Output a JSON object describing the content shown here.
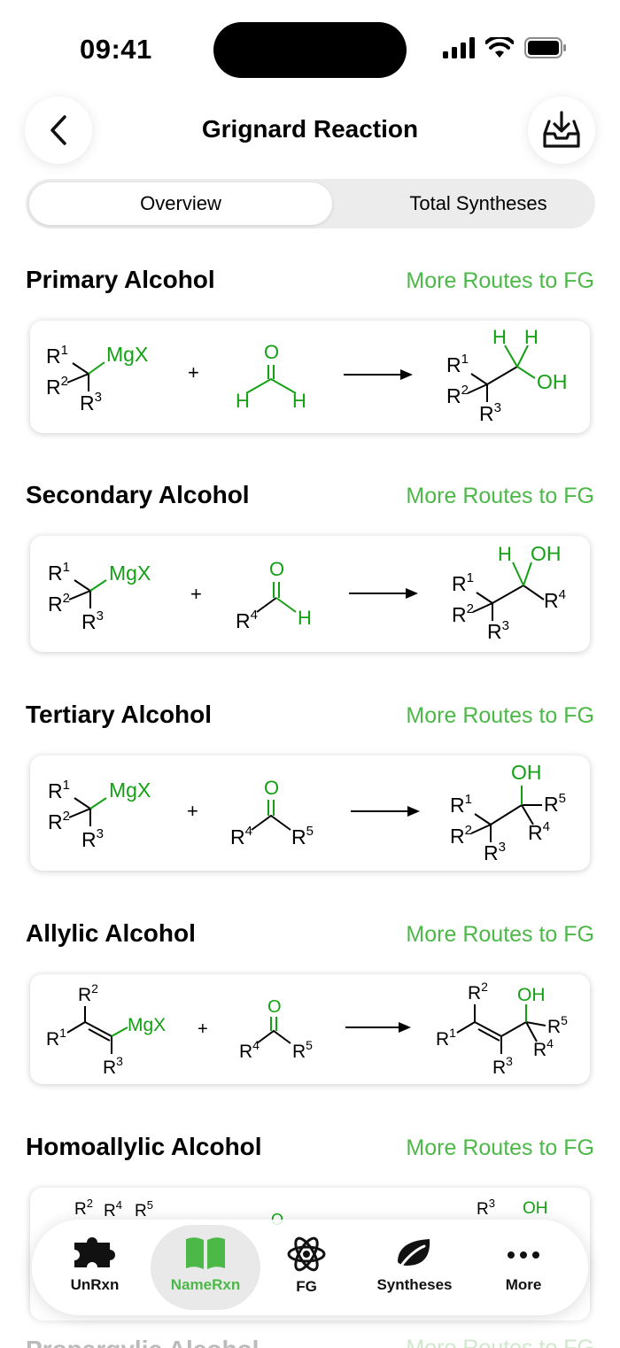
{
  "status_bar": {
    "time": "09:41"
  },
  "nav": {
    "title": "Grignard Reaction"
  },
  "segments": {
    "overview": "Overview",
    "total_syntheses": "Total Syntheses"
  },
  "sections": [
    {
      "title": "Primary Alcohol",
      "link": "More Routes to FG"
    },
    {
      "title": "Secondary Alcohol",
      "link": "More Routes to FG"
    },
    {
      "title": "Tertiary Alcohol",
      "link": "More Routes to FG"
    },
    {
      "title": "Allylic Alcohol",
      "link": "More Routes to FG"
    },
    {
      "title": "Homoallylic Alcohol",
      "link": "More Routes to FG"
    },
    {
      "title": "Propargylic Alcohol",
      "link": "More Routes to FG"
    }
  ],
  "chem": {
    "r1": "R",
    "r2": "R",
    "r3": "R",
    "r4": "R",
    "r5": "R",
    "s1": "1",
    "s2": "2",
    "s3": "3",
    "s4": "4",
    "s5": "5",
    "mgx": "MgX",
    "o": "O",
    "h": "H",
    "oh": "OH",
    "plus": "+"
  },
  "tabbar": {
    "items": [
      {
        "label": "UnRxn",
        "icon": "puzzle-icon"
      },
      {
        "label": "NameRxn",
        "icon": "book-icon"
      },
      {
        "label": "FG",
        "icon": "atom-icon"
      },
      {
        "label": "Syntheses",
        "icon": "leaf-icon"
      },
      {
        "label": "More",
        "icon": "ellipsis-icon"
      }
    ]
  },
  "colors": {
    "accent": "#4cb848",
    "reagent_green": "#14a014",
    "text": "#000000"
  }
}
